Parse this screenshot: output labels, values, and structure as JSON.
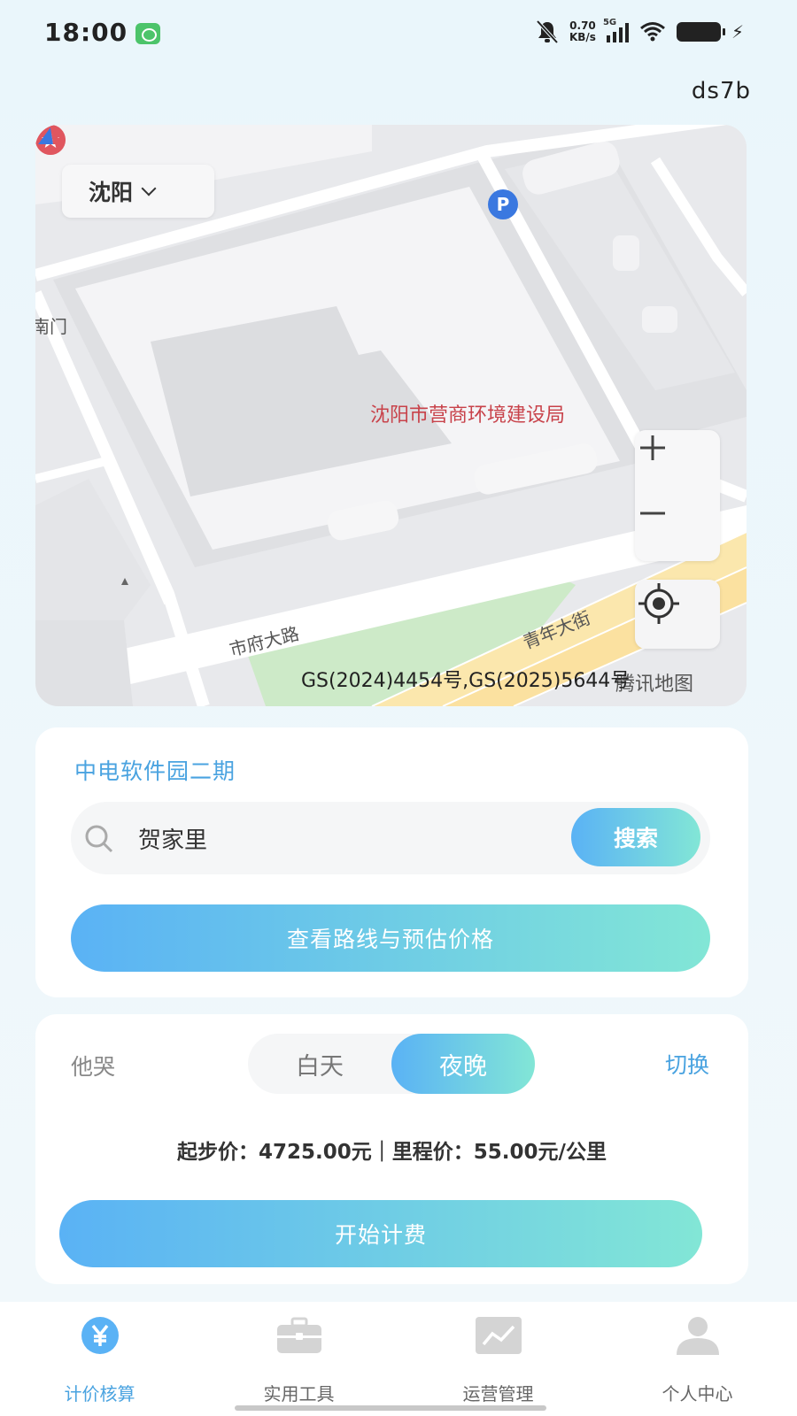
{
  "status_bar": {
    "time": "18:00",
    "net_speed_value": "0.70",
    "net_speed_unit": "KB/s",
    "network": "5G"
  },
  "header": {
    "user_code": "ds7b"
  },
  "map": {
    "city": "沈阳",
    "poi_name": "沈阳市营商环境建设局",
    "gate_label": "南门",
    "road_1": "市府大路",
    "road_2": "青年大街",
    "copyright": "GS(2024)4454号,GS(2025)5644号",
    "provider": "腾讯地图",
    "parking_symbol": "P"
  },
  "search": {
    "location_title": "中电软件园二期",
    "input_value": "贺家里",
    "button_label": "搜索",
    "route_button_label": "查看路线与预估价格"
  },
  "pricing": {
    "vehicle_label": "他哭",
    "day_label": "白天",
    "night_label": "夜晚",
    "selected": "夜晚",
    "switch_label": "切换",
    "price_line": "起步价：4725.00元｜里程价：55.00元/公里",
    "start_button_label": "开始计费"
  },
  "nav": {
    "items": [
      {
        "label": "计价核算",
        "icon": "yuan-icon",
        "active": true
      },
      {
        "label": "实用工具",
        "icon": "briefcase-icon",
        "active": false
      },
      {
        "label": "运营管理",
        "icon": "chart-icon",
        "active": false
      },
      {
        "label": "个人中心",
        "icon": "person-icon",
        "active": false
      }
    ]
  },
  "colors": {
    "accent_blue": "#4aa3e0",
    "gradient_start": "#5ab2f5",
    "gradient_end": "#82e6d6",
    "poi_red": "#e0565f"
  }
}
